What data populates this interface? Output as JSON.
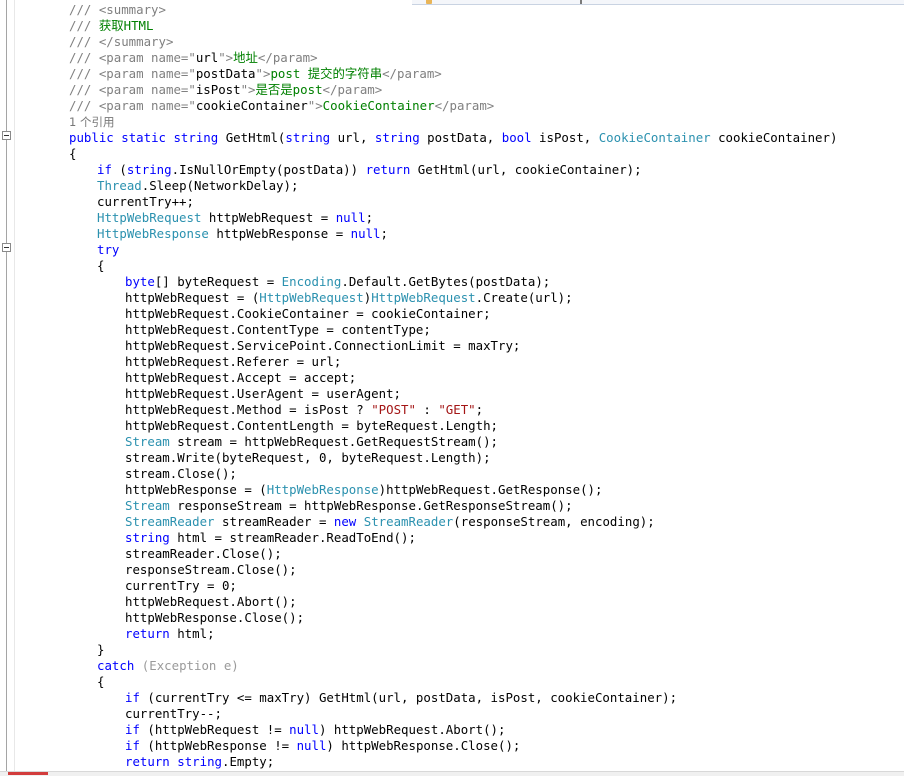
{
  "editor": {
    "language": "C#",
    "colors": {
      "background": "#ffffff",
      "comment": "#008000",
      "xml_doc_tag": "#808080",
      "keyword": "#0000ff",
      "type": "#2b91af",
      "string": "#a31515",
      "code_lens": "#777777",
      "change_marker": "#5ba85b"
    },
    "code_lens": "1 个引用",
    "lines": [
      {
        "indent": 0,
        "tokens": [
          {
            "t": "/// ",
            "c": "t-xml"
          },
          {
            "t": "<summary>",
            "c": "t-xml"
          }
        ]
      },
      {
        "indent": 0,
        "tokens": [
          {
            "t": "/// ",
            "c": "t-xml"
          },
          {
            "t": "获取HTML",
            "c": "t-comment"
          }
        ]
      },
      {
        "indent": 0,
        "tokens": [
          {
            "t": "/// ",
            "c": "t-xml"
          },
          {
            "t": "</summary>",
            "c": "t-xml"
          }
        ]
      },
      {
        "indent": 0,
        "tokens": [
          {
            "t": "/// ",
            "c": "t-xml"
          },
          {
            "t": "<param name=\"",
            "c": "t-xml"
          },
          {
            "t": "url",
            "c": ""
          },
          {
            "t": "\">",
            "c": "t-xml"
          },
          {
            "t": "地址",
            "c": "t-comment"
          },
          {
            "t": "</param>",
            "c": "t-xml"
          }
        ]
      },
      {
        "indent": 0,
        "tokens": [
          {
            "t": "/// ",
            "c": "t-xml"
          },
          {
            "t": "<param name=\"",
            "c": "t-xml"
          },
          {
            "t": "postData",
            "c": ""
          },
          {
            "t": "\">",
            "c": "t-xml"
          },
          {
            "t": "post 提交的字符串",
            "c": "t-comment"
          },
          {
            "t": "</param>",
            "c": "t-xml"
          }
        ]
      },
      {
        "indent": 0,
        "tokens": [
          {
            "t": "/// ",
            "c": "t-xml"
          },
          {
            "t": "<param name=\"",
            "c": "t-xml"
          },
          {
            "t": "isPost",
            "c": ""
          },
          {
            "t": "\">",
            "c": "t-xml"
          },
          {
            "t": "是否是post",
            "c": "t-comment"
          },
          {
            "t": "</param>",
            "c": "t-xml"
          }
        ]
      },
      {
        "indent": 0,
        "tokens": [
          {
            "t": "/// ",
            "c": "t-xml"
          },
          {
            "t": "<param name=\"",
            "c": "t-xml"
          },
          {
            "t": "cookieContainer",
            "c": ""
          },
          {
            "t": "\">",
            "c": "t-xml"
          },
          {
            "t": "CookieContainer",
            "c": "t-comment"
          },
          {
            "t": "</param>",
            "c": "t-xml"
          }
        ]
      },
      {
        "indent": 0,
        "tokens": [
          {
            "t": "1 个引用",
            "c": "t-ref"
          }
        ]
      },
      {
        "indent": 0,
        "tokens": [
          {
            "t": "public",
            "c": "t-kw"
          },
          {
            "t": " ",
            "c": ""
          },
          {
            "t": "static",
            "c": "t-kw"
          },
          {
            "t": " ",
            "c": ""
          },
          {
            "t": "string",
            "c": "t-kw"
          },
          {
            "t": " GetHtml(",
            "c": ""
          },
          {
            "t": "string",
            "c": "t-kw"
          },
          {
            "t": " url, ",
            "c": ""
          },
          {
            "t": "string",
            "c": "t-kw"
          },
          {
            "t": " postData, ",
            "c": ""
          },
          {
            "t": "bool",
            "c": "t-kw"
          },
          {
            "t": " isPost, ",
            "c": ""
          },
          {
            "t": "CookieContainer",
            "c": "t-type"
          },
          {
            "t": " cookieContainer)",
            "c": ""
          }
        ]
      },
      {
        "indent": 0,
        "tokens": [
          {
            "t": "{",
            "c": ""
          }
        ]
      },
      {
        "indent": 1,
        "tokens": [
          {
            "t": "if",
            "c": "t-kw"
          },
          {
            "t": " (",
            "c": ""
          },
          {
            "t": "string",
            "c": "t-kw"
          },
          {
            "t": ".IsNullOrEmpty(postData)) ",
            "c": ""
          },
          {
            "t": "return",
            "c": "t-kw"
          },
          {
            "t": " GetHtml(url, cookieContainer);",
            "c": ""
          }
        ]
      },
      {
        "indent": 1,
        "tokens": [
          {
            "t": "Thread",
            "c": "t-type"
          },
          {
            "t": ".Sleep(NetworkDelay);",
            "c": ""
          }
        ]
      },
      {
        "indent": 1,
        "tokens": [
          {
            "t": "currentTry++;",
            "c": ""
          }
        ]
      },
      {
        "indent": 1,
        "tokens": [
          {
            "t": "HttpWebRequest",
            "c": "t-type"
          },
          {
            "t": " httpWebRequest = ",
            "c": ""
          },
          {
            "t": "null",
            "c": "t-kw"
          },
          {
            "t": ";",
            "c": ""
          }
        ]
      },
      {
        "indent": 1,
        "tokens": [
          {
            "t": "HttpWebResponse",
            "c": "t-type"
          },
          {
            "t": " httpWebResponse = ",
            "c": ""
          },
          {
            "t": "null",
            "c": "t-kw"
          },
          {
            "t": ";",
            "c": ""
          }
        ]
      },
      {
        "indent": 1,
        "tokens": [
          {
            "t": "try",
            "c": "t-kw"
          }
        ]
      },
      {
        "indent": 1,
        "tokens": [
          {
            "t": "{",
            "c": ""
          }
        ]
      },
      {
        "indent": 2,
        "tokens": [
          {
            "t": "byte",
            "c": "t-kw"
          },
          {
            "t": "[] byteRequest = ",
            "c": ""
          },
          {
            "t": "Encoding",
            "c": "t-type"
          },
          {
            "t": ".Default.GetBytes(postData);",
            "c": ""
          }
        ]
      },
      {
        "indent": 2,
        "tokens": [
          {
            "t": "httpWebRequest = (",
            "c": ""
          },
          {
            "t": "HttpWebRequest",
            "c": "t-type"
          },
          {
            "t": ")",
            "c": ""
          },
          {
            "t": "HttpWebRequest",
            "c": "t-type"
          },
          {
            "t": ".Create(url);",
            "c": ""
          }
        ]
      },
      {
        "indent": 2,
        "tokens": [
          {
            "t": "httpWebRequest.CookieContainer = cookieContainer;",
            "c": ""
          }
        ]
      },
      {
        "indent": 2,
        "tokens": [
          {
            "t": "httpWebRequest.ContentType = contentType;",
            "c": ""
          }
        ]
      },
      {
        "indent": 2,
        "tokens": [
          {
            "t": "httpWebRequest.ServicePoint.ConnectionLimit = maxTry;",
            "c": ""
          }
        ]
      },
      {
        "indent": 2,
        "tokens": [
          {
            "t": "httpWebRequest.Referer = url;",
            "c": ""
          }
        ]
      },
      {
        "indent": 2,
        "tokens": [
          {
            "t": "httpWebRequest.Accept = accept;",
            "c": ""
          }
        ]
      },
      {
        "indent": 2,
        "tokens": [
          {
            "t": "httpWebRequest.UserAgent = userAgent;",
            "c": ""
          }
        ]
      },
      {
        "indent": 2,
        "tokens": [
          {
            "t": "httpWebRequest.Method = isPost ? ",
            "c": ""
          },
          {
            "t": "\"POST\"",
            "c": "t-str"
          },
          {
            "t": " : ",
            "c": ""
          },
          {
            "t": "\"GET\"",
            "c": "t-str"
          },
          {
            "t": ";",
            "c": ""
          }
        ]
      },
      {
        "indent": 2,
        "tokens": [
          {
            "t": "httpWebRequest.ContentLength = byteRequest.Length;",
            "c": ""
          }
        ]
      },
      {
        "indent": 2,
        "tokens": [
          {
            "t": "Stream",
            "c": "t-type"
          },
          {
            "t": " stream = httpWebRequest.GetRequestStream();",
            "c": ""
          }
        ]
      },
      {
        "indent": 2,
        "tokens": [
          {
            "t": "stream.Write(byteRequest, 0, byteRequest.Length);",
            "c": ""
          }
        ]
      },
      {
        "indent": 2,
        "tokens": [
          {
            "t": "stream.Close();",
            "c": ""
          }
        ]
      },
      {
        "indent": 2,
        "tokens": [
          {
            "t": "httpWebResponse = (",
            "c": ""
          },
          {
            "t": "HttpWebResponse",
            "c": "t-type"
          },
          {
            "t": ")httpWebRequest.GetResponse();",
            "c": ""
          }
        ]
      },
      {
        "indent": 2,
        "tokens": [
          {
            "t": "Stream",
            "c": "t-type"
          },
          {
            "t": " responseStream = httpWebResponse.GetResponseStream();",
            "c": ""
          }
        ]
      },
      {
        "indent": 2,
        "tokens": [
          {
            "t": "StreamReader",
            "c": "t-type"
          },
          {
            "t": " streamReader = ",
            "c": ""
          },
          {
            "t": "new",
            "c": "t-kw"
          },
          {
            "t": " ",
            "c": ""
          },
          {
            "t": "StreamReader",
            "c": "t-type"
          },
          {
            "t": "(responseStream, encoding);",
            "c": ""
          }
        ]
      },
      {
        "indent": 2,
        "tokens": [
          {
            "t": "string",
            "c": "t-kw"
          },
          {
            "t": " html = streamReader.ReadToEnd();",
            "c": ""
          }
        ]
      },
      {
        "indent": 2,
        "tokens": [
          {
            "t": "streamReader.Close();",
            "c": ""
          }
        ]
      },
      {
        "indent": 2,
        "tokens": [
          {
            "t": "responseStream.Close();",
            "c": ""
          }
        ]
      },
      {
        "indent": 2,
        "tokens": [
          {
            "t": "currentTry = 0;",
            "c": ""
          }
        ]
      },
      {
        "indent": 2,
        "tokens": [
          {
            "t": "httpWebRequest.Abort();",
            "c": ""
          }
        ]
      },
      {
        "indent": 2,
        "tokens": [
          {
            "t": "httpWebResponse.Close();",
            "c": ""
          }
        ]
      },
      {
        "indent": 2,
        "tokens": [
          {
            "t": "return",
            "c": "t-kw"
          },
          {
            "t": " html;",
            "c": ""
          }
        ]
      },
      {
        "indent": 1,
        "tokens": [
          {
            "t": "}",
            "c": ""
          }
        ]
      },
      {
        "indent": 1,
        "tokens": [
          {
            "t": "catch",
            "c": "t-kw"
          },
          {
            "t": " (",
            "c": "t-dim"
          },
          {
            "t": "Exception",
            "c": "t-type t-dim"
          },
          {
            "t": " e)",
            "c": "t-dim"
          }
        ]
      },
      {
        "indent": 1,
        "tokens": [
          {
            "t": "{",
            "c": ""
          }
        ]
      },
      {
        "indent": 2,
        "tokens": [
          {
            "t": "if",
            "c": "t-kw"
          },
          {
            "t": " (currentTry <= maxTry) GetHtml(url, postData, isPost, cookieContainer);",
            "c": ""
          }
        ]
      },
      {
        "indent": 2,
        "tokens": [
          {
            "t": "currentTry--;",
            "c": ""
          }
        ]
      },
      {
        "indent": 2,
        "tokens": [
          {
            "t": "if",
            "c": "t-kw"
          },
          {
            "t": " (httpWebRequest != ",
            "c": ""
          },
          {
            "t": "null",
            "c": "t-kw"
          },
          {
            "t": ") httpWebRequest.Abort();",
            "c": ""
          }
        ]
      },
      {
        "indent": 2,
        "tokens": [
          {
            "t": "if",
            "c": "t-kw"
          },
          {
            "t": " (httpWebResponse != ",
            "c": ""
          },
          {
            "t": "null",
            "c": "t-kw"
          },
          {
            "t": ") httpWebResponse.Close();",
            "c": ""
          }
        ]
      },
      {
        "indent": 2,
        "tokens": [
          {
            "t": "return",
            "c": "t-kw"
          },
          {
            "t": " ",
            "c": ""
          },
          {
            "t": "string",
            "c": "t-kw"
          },
          {
            "t": ".Empty;",
            "c": ""
          }
        ]
      }
    ]
  }
}
